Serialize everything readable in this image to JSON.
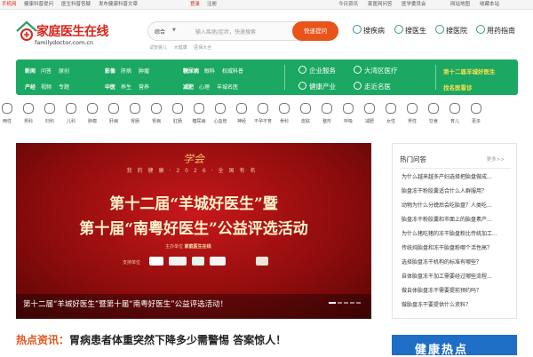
{
  "topbar": {
    "left": [
      "手机网",
      "健康科普提问",
      "医生科普答疑",
      "发布健康科普文章"
    ],
    "center": [
      "登录",
      "注册"
    ],
    "right": [
      "今日资讯",
      "家医网问答",
      "医学委员会",
      "网站地图",
      "收藏本站"
    ]
  },
  "logo": {
    "brand": "家庭医生在线",
    "domain": "familydoctor.com.cn"
  },
  "search": {
    "scope": "综合",
    "placeholder": "输入疾病/症状，快速搜索",
    "button": "快速提问"
  },
  "hot_tags": [
    "试管婴儿",
    "大健康",
    "医保大全"
  ],
  "quick_links": [
    "搜疾病",
    "搜医生",
    "搜医院",
    "用药指南"
  ],
  "nav": {
    "row1": [
      {
        "bold": "新闻",
        "items": [
          "问答",
          "原创"
        ]
      },
      {
        "bold": "影像",
        "items": [
          "肝病",
          "肿瘤"
        ]
      },
      {
        "bold": "糖尿病",
        "items": [
          "眼科",
          "权威科普"
        ]
      }
    ],
    "row2": [
      {
        "bold": "产经",
        "items": [
          "视频",
          "专题"
        ]
      },
      {
        "bold": "中医",
        "items": [
          "养生",
          "营养"
        ]
      },
      {
        "bold": "减肥",
        "items": [
          "心理",
          "羊城名医"
        ]
      }
    ],
    "services": [
      "企业服务",
      "大湾区医疗",
      "健康产业",
      "走近名医"
    ],
    "special": [
      "第十二届羊城好医生",
      "找名医看诊"
    ]
  },
  "icons": [
    "两性",
    "男科",
    "妇科",
    "儿科",
    "肿瘤",
    "肝病",
    "胃肠",
    "胃病",
    "肛肠",
    "糖尿病",
    "心血管",
    "神经",
    "不孕不育",
    "骨科",
    "皮肤",
    "整形",
    "呼吸",
    "减肥",
    "女性",
    "男性",
    "饮食",
    "育儿",
    "更多"
  ],
  "banner": {
    "emblem": "学会",
    "top": "我的健康·2026·全国有名",
    "line1": "第十二届“羊城好医生”暨",
    "line2": "第十届“南粤好医生”公益评选活动",
    "organizer": "主办单位",
    "organizer_name": "家庭医生在线",
    "support": "支持单位",
    "caption": "第十二届“羊城好医生”暨第十届“南粤好医生”公益评选活动！"
  },
  "hotnews": {
    "label": "热点资讯：",
    "text": "胃病患者体重突然下降多少需警惕 答案惊人！"
  },
  "qa": {
    "title": "热门问答",
    "more": "更多>>",
    "items": [
      "为什么越来越多产妇选择把胎盘做成...",
      "胎盘冻干粉胶囊适合什么人群服用？",
      "动物为什么分娩后会吃胎盘？人类吃...",
      "胎盘冻干粉胶囊和市面上的胎盘素产...",
      "为什么猪吃猪的冻干胎盘粉比传统加工...",
      "传统炖胎盘和冻干胎盘粉哪个活性高？",
      "选择胎盘冻干机构的标准有哪些？",
      "自体胎盘冻干加工需要经过哪些流程...",
      "做自体胎盘冻干需要提前预约吗？",
      "做胎盘冻干要提供什么资料？"
    ]
  },
  "ad": {
    "text": "健康热点"
  },
  "colors": {
    "green": "#1aa862",
    "red": "#d9261c",
    "orange": "#e9541a"
  }
}
